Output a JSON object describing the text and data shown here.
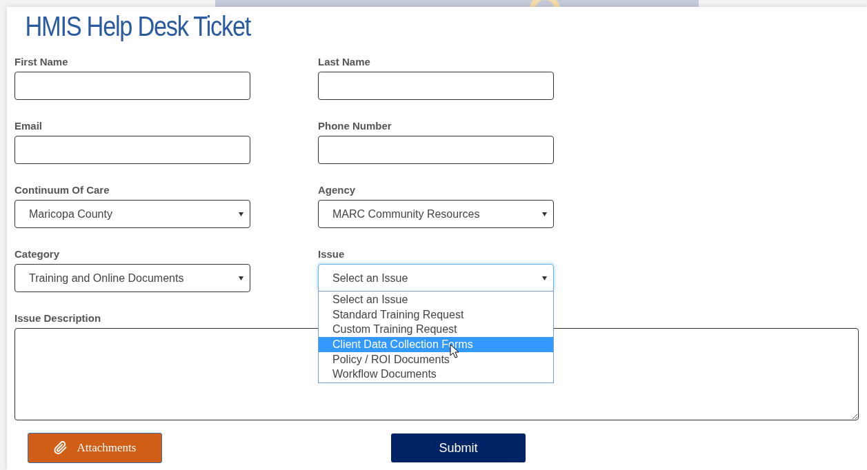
{
  "title": "HMIS Help Desk Ticket",
  "fields": [
    {
      "kind": "text",
      "label": "First Name"
    },
    {
      "kind": "text",
      "label": "Last Name"
    },
    {
      "kind": "text",
      "label": "Email"
    },
    {
      "kind": "text",
      "label": "Phone Number"
    },
    {
      "kind": "select",
      "label": "Continuum Of Care",
      "value": "Maricopa County",
      "focused": false
    },
    {
      "kind": "select",
      "label": "Agency",
      "value": "MARC Community Resources",
      "focused": false
    },
    {
      "kind": "select",
      "label": "Category",
      "value": "Training and Online Documents",
      "focused": false
    },
    {
      "kind": "select",
      "label": "Issue",
      "value": "Select an Issue",
      "focused": true
    },
    {
      "kind": "textarea",
      "label": "Issue Description"
    }
  ],
  "dropdown": {
    "expanded": true,
    "options": [
      {
        "label": "Select an Issue",
        "selected": false
      },
      {
        "label": "Standard Training Request",
        "selected": false
      },
      {
        "label": "Custom Training Request",
        "selected": false
      },
      {
        "label": "Client Data Collection Forms",
        "selected": true
      },
      {
        "label": "Policy / ROI Documents",
        "selected": false
      },
      {
        "label": "Workflow Documents",
        "selected": false
      }
    ]
  },
  "buttons": [
    {
      "kind": "attach",
      "label": "Attachments"
    },
    {
      "kind": "submit",
      "label": "Submit"
    }
  ]
}
